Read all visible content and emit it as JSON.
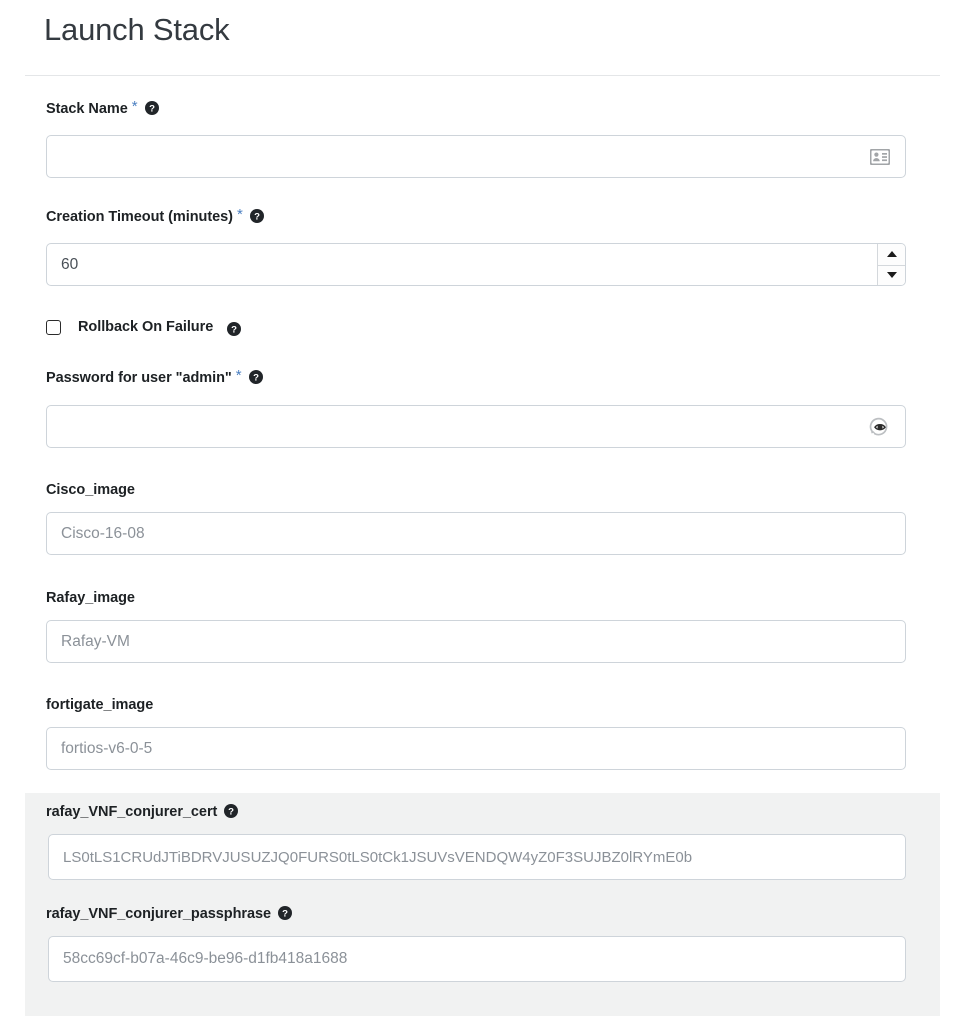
{
  "page": {
    "title": "Launch Stack"
  },
  "icons": {
    "help": "help-circle-icon",
    "id_card": "id-card-icon",
    "eye_toggle": "eye-reveal-icon",
    "spinner_up": "caret-up-icon",
    "spinner_down": "caret-down-icon",
    "checkbox": "checkbox-unchecked-icon"
  },
  "colors": {
    "required_asterisk": "#4a7fc1",
    "label_text": "#1d2124",
    "placeholder": "#8b9198",
    "input_border": "#ced4da",
    "shaded_section_bg": "#f1f2f2",
    "title_text": "#343a40",
    "rule": "#e4e6e8"
  },
  "fields": {
    "stack_name": {
      "label": "Stack Name",
      "required": true,
      "required_marker": "*",
      "value": "",
      "placeholder": "",
      "trailing_icon": "id-card-icon"
    },
    "creation_timeout": {
      "label": "Creation Timeout (minutes)",
      "required": true,
      "required_marker": "*",
      "value": "60",
      "placeholder": "60",
      "has_spinner": true
    },
    "rollback_on_failure": {
      "label": "Rollback On Failure",
      "checked": false
    },
    "admin_password": {
      "label": "Password for user \"admin\"",
      "required": true,
      "required_marker": "*",
      "value": "",
      "placeholder": "",
      "trailing_icon": "eye-reveal-icon"
    },
    "cisco_image": {
      "label": "Cisco_image",
      "required": false,
      "value": "",
      "placeholder": "Cisco-16-08"
    },
    "rafay_image": {
      "label": "Rafay_image",
      "required": false,
      "value": "",
      "placeholder": "Rafay-VM"
    },
    "fortigate_image": {
      "label": "fortigate_image",
      "required": false,
      "value": "",
      "placeholder": "fortios-v6-0-5"
    },
    "rafay_vnf_conjurer_cert": {
      "label": "rafay_VNF_conjurer_cert",
      "required": false,
      "value": "",
      "placeholder": "LS0tLS1CRUdJTiBDRVJUSUZJQ0FURS0tLS0tCk1JSUVsVENDQW4yZ0F3SUJBZ0lRYmE0b"
    },
    "rafay_vnf_conjurer_passphrase": {
      "label": "rafay_VNF_conjurer_passphrase",
      "required": false,
      "value": "",
      "placeholder": "58cc69cf-b07a-46c9-be96-d1fb418a1688"
    }
  }
}
